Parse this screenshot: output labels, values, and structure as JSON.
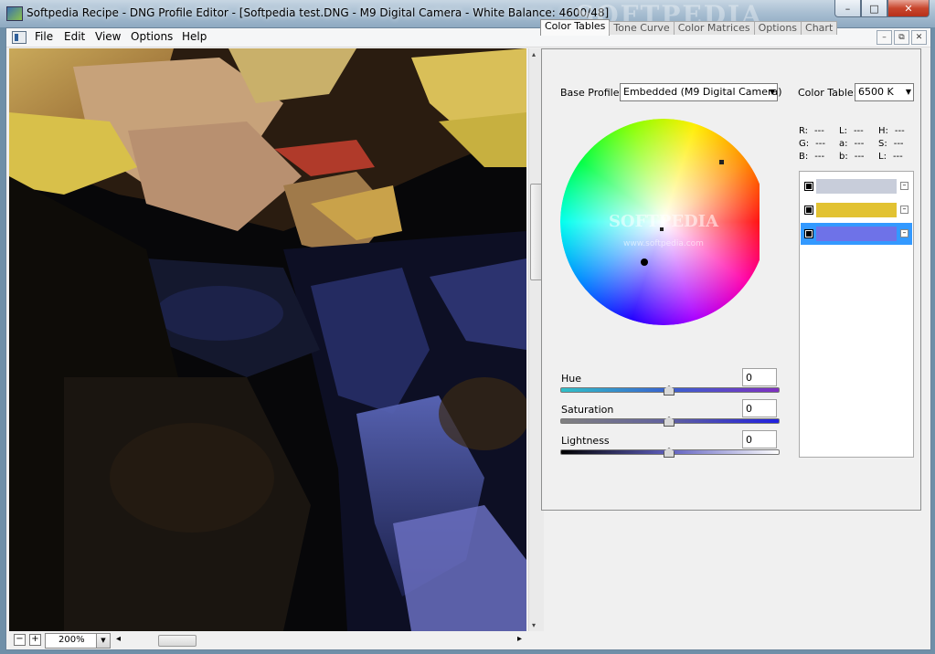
{
  "window": {
    "title": "Softpedia Recipe - DNG Profile Editor - [Softpedia test.DNG  - M9 Digital Camera - White Balance: 4600/48]",
    "watermark": "SOFTPEDIA",
    "controls": {
      "minimize": "–",
      "maximize": "□",
      "close": "✕"
    }
  },
  "menubar": {
    "items": [
      "File",
      "Edit",
      "View",
      "Options",
      "Help"
    ],
    "mdi_controls": [
      "–",
      "⧉",
      "✕"
    ]
  },
  "viewer": {
    "zoom_out": "−",
    "zoom_in": "+",
    "zoom_value": "200%",
    "scroll_left": "◂",
    "scroll_right": "▸",
    "scroll_up": "▴",
    "scroll_down": "▾"
  },
  "tabs": [
    "Color Tables",
    "Tone Curve",
    "Color Matrices",
    "Options",
    "Chart"
  ],
  "active_tab": "Color Tables",
  "profile": {
    "base_profile_label": "Base Profile:",
    "base_profile_value": "Embedded (M9 Digital Camera)",
    "color_table_label": "Color Table:",
    "color_table_value": "6500 K"
  },
  "wheel_watermark": "SOFTPEDIA",
  "wheel_url": "www.softpedia.com",
  "readout": {
    "rows": [
      [
        {
          "k": "R:",
          "v": "---"
        },
        {
          "k": "L:",
          "v": "---"
        },
        {
          "k": "H:",
          "v": "---"
        }
      ],
      [
        {
          "k": "G:",
          "v": "---"
        },
        {
          "k": "a:",
          "v": "---"
        },
        {
          "k": "S:",
          "v": "---"
        }
      ],
      [
        {
          "k": "B:",
          "v": "---"
        },
        {
          "k": "b:",
          "v": "---"
        },
        {
          "k": "L:",
          "v": "---"
        }
      ]
    ]
  },
  "swatches": [
    {
      "color": "#c8cdda",
      "selected": false
    },
    {
      "color": "#e2c232",
      "selected": false
    },
    {
      "color": "#6e72e8",
      "selected": true
    }
  ],
  "sliders": [
    {
      "label": "Hue",
      "value": "0",
      "level": 0.5
    },
    {
      "label": "Saturation",
      "value": "0",
      "level": 0.5
    },
    {
      "label": "Lightness",
      "value": "0",
      "level": 0.5
    }
  ],
  "colors": {
    "accent": "#3399ff",
    "titlebar": "#a9bfd2"
  }
}
